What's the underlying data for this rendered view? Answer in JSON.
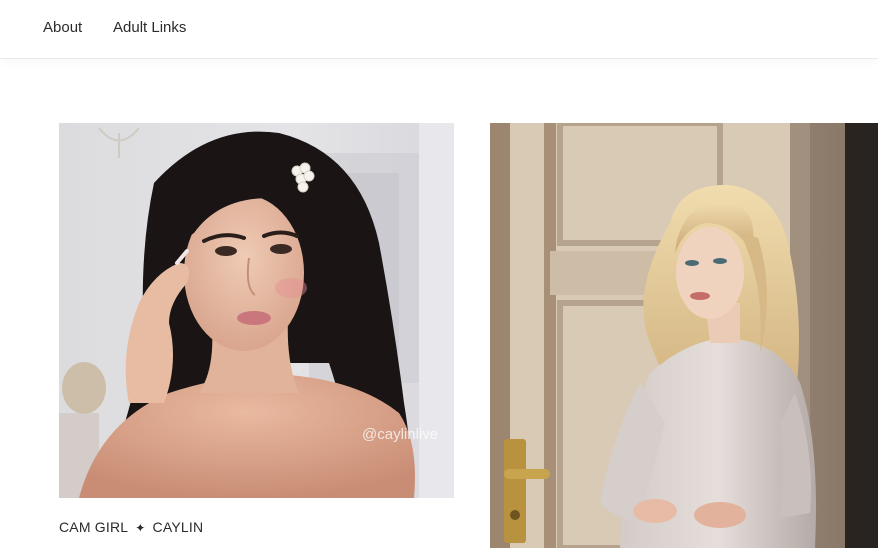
{
  "nav": {
    "items": [
      {
        "label": "About"
      },
      {
        "label": "Adult Links"
      }
    ]
  },
  "gallery": {
    "cards": [
      {
        "title_left": "CAM GIRL",
        "separator": "✦",
        "title_right": "CAYLIN",
        "watermark": "@caylinlive"
      },
      {
        "title_left": "",
        "title_right": ""
      }
    ]
  },
  "colors": {
    "text": "#2b2b2b",
    "nav_border": "#ebebeb",
    "background": "#ffffff"
  }
}
